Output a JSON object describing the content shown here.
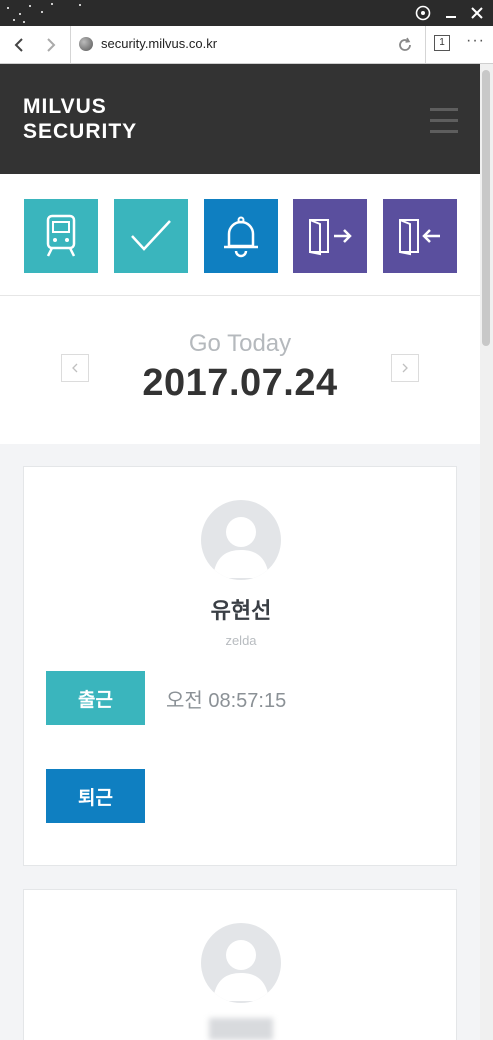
{
  "browser": {
    "url": "security.milvus.co.kr",
    "tab_count": "1",
    "icons": {
      "back": "chevron-left-icon",
      "forward": "chevron-right-icon",
      "reload": "reload-icon",
      "more": "more-icon",
      "download": "download-icon",
      "minimize": "minimize-icon",
      "close": "close-icon"
    }
  },
  "header": {
    "logo_line1": "MILVUS",
    "logo_line2": "SECURITY",
    "menu_icon": "hamburger-icon"
  },
  "quick_actions": [
    {
      "name": "commute",
      "icon": "train-icon",
      "color": "#3ab5bd"
    },
    {
      "name": "check",
      "icon": "checkmark-icon",
      "color": "#3ab5bd"
    },
    {
      "name": "alarm",
      "icon": "bell-icon",
      "color": "#0f7fc1"
    },
    {
      "name": "exit",
      "icon": "door-exit-icon",
      "color": "#5a4f9e"
    },
    {
      "name": "enter",
      "icon": "door-enter-icon",
      "color": "#5a4f9e"
    }
  ],
  "date_panel": {
    "go_today": "Go Today",
    "date": "2017.07.24",
    "prev_icon": "chevron-left-icon",
    "next_icon": "chevron-right-icon"
  },
  "cards": [
    {
      "name": "유현선",
      "user_id": "zelda",
      "checkin_label": "출근",
      "checkin_time": "오전 08:57:15",
      "checkout_label": "퇴근",
      "checkin_color": "#3ab5bd",
      "checkout_color": "#0f7fc1"
    }
  ],
  "colors": {
    "header_bg": "#333333",
    "teal": "#3ab5bd",
    "blue": "#0f7fc1",
    "purple": "#5a4f9e"
  }
}
